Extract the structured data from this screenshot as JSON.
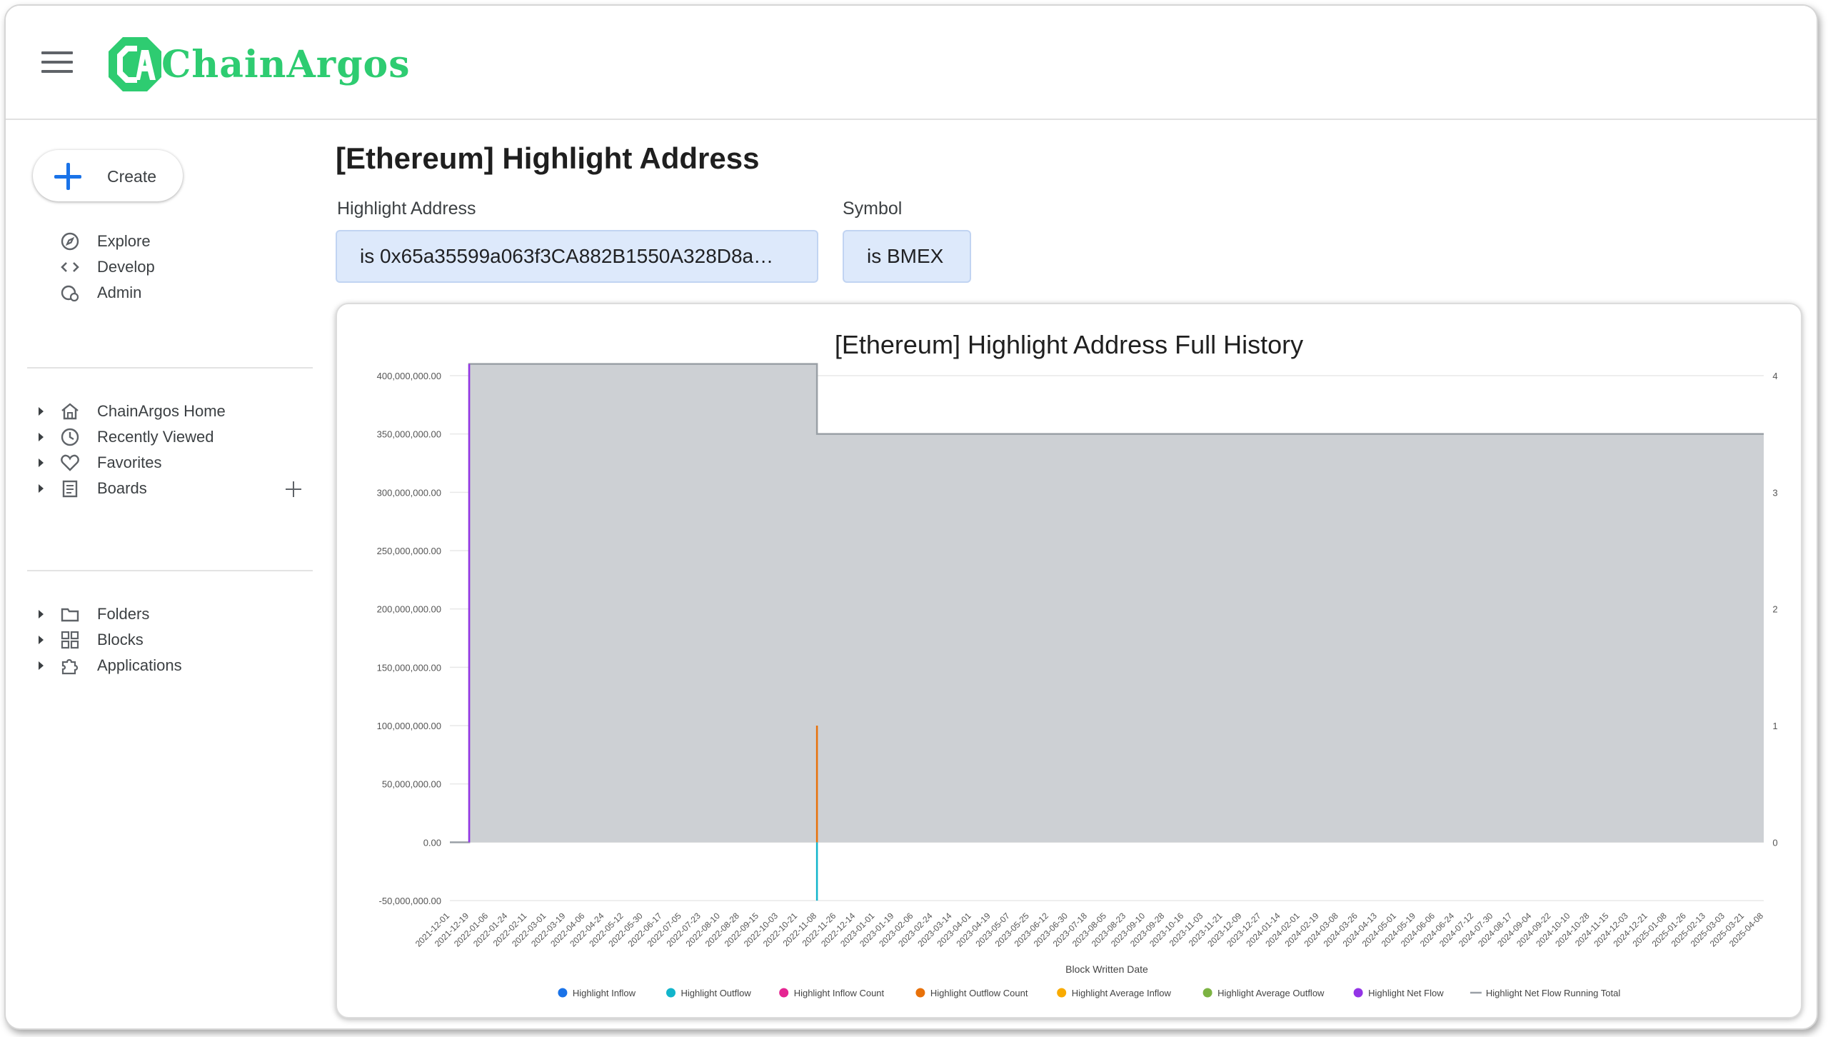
{
  "app": {
    "logo_text": "ChainArgos"
  },
  "sidebar": {
    "create_label": "Create",
    "primary": [
      {
        "label": "Explore",
        "icon": "compass-icon"
      },
      {
        "label": "Develop",
        "icon": "code-icon"
      },
      {
        "label": "Admin",
        "icon": "admin-gear-icon"
      }
    ],
    "sections": [
      {
        "label": "ChainArgos Home",
        "icon": "home-icon"
      },
      {
        "label": "Recently Viewed",
        "icon": "clock-icon"
      },
      {
        "label": "Favorites",
        "icon": "heart-icon"
      },
      {
        "label": "Boards",
        "icon": "board-icon"
      }
    ],
    "library": [
      {
        "label": "Folders",
        "icon": "folder-icon"
      },
      {
        "label": "Blocks",
        "icon": "blocks-icon"
      },
      {
        "label": "Applications",
        "icon": "puzzle-icon"
      }
    ]
  },
  "page": {
    "title": "[Ethereum] Highlight Address"
  },
  "filters": [
    {
      "label": "Highlight Address",
      "value": "is 0x65a35599a063f3CA882B1550A328D8a…"
    },
    {
      "label": "Symbol",
      "value": "is BMEX"
    }
  ],
  "colors": {
    "accent": "#1a73e8",
    "logo": "#2ecc71",
    "filter_bg": "#dde9fb",
    "area_fill": "#cdd0d4",
    "area_line": "#9aa0a6",
    "net_flow": "#8e44e8"
  },
  "chart_data": {
    "type": "area",
    "title": "[Ethereum] Highlight Address Full History",
    "xlabel": "Block Written Date",
    "ylabel": "",
    "ylim": [
      -50000000,
      400000000
    ],
    "y_ticks": [
      "400,000,000.00",
      "350,000,000.00",
      "300,000,000.00",
      "250,000,000.00",
      "200,000,000.00",
      "150,000,000.00",
      "100,000,000.00",
      "50,000,000.00",
      "0.00",
      "-50,000,000.00"
    ],
    "y2lim": [
      0,
      4
    ],
    "y2_ticks": [
      "4",
      "3",
      "2",
      "1",
      "0"
    ],
    "x_ticks": [
      "2021-12-01",
      "2021-12-19",
      "2022-01-06",
      "2022-01-24",
      "2022-02-11",
      "2022-03-01",
      "2022-03-19",
      "2022-04-06",
      "2022-04-24",
      "2022-05-12",
      "2022-05-30",
      "2022-06-17",
      "2022-07-05",
      "2022-07-23",
      "2022-08-10",
      "2022-08-28",
      "2022-09-15",
      "2022-10-03",
      "2022-10-21",
      "2022-11-08",
      "2022-11-26",
      "2022-12-14",
      "2023-01-01",
      "2023-01-19",
      "2023-02-06",
      "2023-02-24",
      "2023-03-14",
      "2023-04-01",
      "2023-04-19",
      "2023-05-07",
      "2023-05-25",
      "2023-06-12",
      "2023-06-30",
      "2023-07-18",
      "2023-08-05",
      "2023-08-23",
      "2023-09-10",
      "2023-09-28",
      "2023-10-16",
      "2023-11-03",
      "2023-11-21",
      "2023-12-09",
      "2023-12-27",
      "2024-01-14",
      "2024-02-01",
      "2024-02-19",
      "2024-03-08",
      "2024-03-26",
      "2024-04-13",
      "2024-05-01",
      "2024-05-19",
      "2024-06-06",
      "2024-06-24",
      "2024-07-12",
      "2024-07-30",
      "2024-08-17",
      "2024-09-04",
      "2024-09-22",
      "2024-10-10",
      "2024-10-28",
      "2024-11-15",
      "2024-12-03",
      "2024-12-21",
      "2025-01-08",
      "2025-01-26",
      "2025-02-13",
      "2025-03-03",
      "2025-03-21",
      "2025-04-08"
    ],
    "series": [
      {
        "name": "Highlight Inflow",
        "color": "#1a73e8",
        "marker": "dot"
      },
      {
        "name": "Highlight Outflow",
        "color": "#12b5cb",
        "marker": "dot",
        "events": [
          {
            "x": "2022-11-08",
            "y": -50000000
          }
        ]
      },
      {
        "name": "Highlight Inflow Count",
        "color": "#e52592",
        "marker": "dot"
      },
      {
        "name": "Highlight Outflow Count",
        "color": "#e8710a",
        "marker": "dot",
        "events": [
          {
            "x": "2022-11-08",
            "y": 1
          }
        ]
      },
      {
        "name": "Highlight Average Inflow",
        "color": "#f9ab00",
        "marker": "dot"
      },
      {
        "name": "Highlight Average Outflow",
        "color": "#7cb342",
        "marker": "dot"
      },
      {
        "name": "Highlight Net Flow",
        "color": "#9334e6",
        "marker": "dot",
        "events": [
          {
            "x": "2021-12-19",
            "y": 410000000
          }
        ]
      },
      {
        "name": "Highlight Net Flow Running Total",
        "color": "#9aa0a6",
        "marker": "line",
        "points": [
          {
            "x": "2021-12-01",
            "y": 0
          },
          {
            "x": "2021-12-19",
            "y": 0
          },
          {
            "x": "2021-12-19",
            "y": 410000000
          },
          {
            "x": "2022-11-08",
            "y": 410000000
          },
          {
            "x": "2022-11-08",
            "y": 350000000
          },
          {
            "x": "2025-04-08",
            "y": 350000000
          }
        ]
      }
    ],
    "grid": true,
    "legend_position": "bottom"
  }
}
